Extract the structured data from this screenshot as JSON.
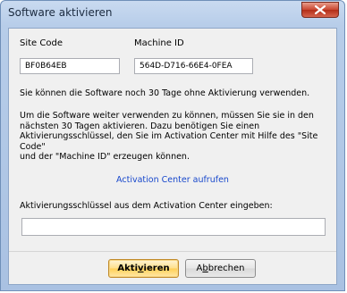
{
  "window": {
    "title": "Software aktivieren"
  },
  "fields": {
    "site_code_label": "Site Code",
    "site_code_value": "BF0B64EB",
    "machine_id_label": "Machine ID",
    "machine_id_value": "564D-D716-66E4-0FEA"
  },
  "text": {
    "trial_notice": "Sie können die Software noch 30 Tage ohne Aktivierung verwenden.",
    "instructions": "Um die Software weiter verwenden zu können, müssen Sie sie in den\nnächsten 30 Tagen aktivieren. Dazu benötigen Sie einen\nAktivierungsschlüssel, den Sie im Activation Center mit Hilfe des \"Site Code\"\nund der \"Machine ID\" erzeugen können.",
    "activation_link": "Activation Center aufrufen",
    "key_prompt": "Aktivierungsschlüssel aus dem Activation Center eingeben:"
  },
  "buttons": {
    "activate_pre": "Akti",
    "activate_ul": "v",
    "activate_post": "ieren",
    "cancel_pre": "A",
    "cancel_ul": "b",
    "cancel_post": "brechen"
  },
  "colors": {
    "link": "#1848cc",
    "primary_button": "#ffd86b"
  }
}
